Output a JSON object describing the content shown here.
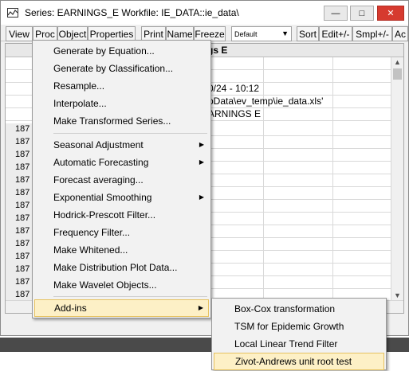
{
  "window": {
    "title": "Series: EARNINGS_E   Workfile: IE_DATA::ie_data\\",
    "controls": {
      "minimize": "—",
      "maximize": "□",
      "close": "✕"
    }
  },
  "toolbar": {
    "buttons": [
      "View",
      "Proc",
      "Object",
      "Properties",
      "Print",
      "Name",
      "Freeze",
      "Sort",
      "Edit+/-",
      "Smpl+/-",
      "Ac"
    ],
    "dropdown_value": "Default"
  },
  "sheet": {
    "header_title": "gs E",
    "cells": {
      "date_line": "0/24 - 10:12",
      "path_line": "pData\\ev_temp\\ie_data.xls'",
      "name_line": "ARNINGS E"
    },
    "row_labels": [
      "187",
      "187",
      "187",
      "187",
      "187",
      "187",
      "187",
      "187",
      "187",
      "187",
      "187",
      "187",
      "187",
      "187"
    ]
  },
  "proc_menu": {
    "items": [
      {
        "label": "Generate by Equation...",
        "submenu": false
      },
      {
        "label": "Generate by Classification...",
        "submenu": false
      },
      {
        "label": "Resample...",
        "submenu": false
      },
      {
        "label": "Interpolate...",
        "submenu": false
      },
      {
        "label": "Make Transformed Series...",
        "submenu": false
      },
      {
        "label": "Seasonal Adjustment",
        "submenu": true
      },
      {
        "label": "Automatic Forecasting",
        "submenu": true
      },
      {
        "label": "Forecast averaging...",
        "submenu": false
      },
      {
        "label": "Exponential Smoothing",
        "submenu": true
      },
      {
        "label": "Hodrick-Prescott Filter...",
        "submenu": false
      },
      {
        "label": "Frequency Filter...",
        "submenu": false
      },
      {
        "label": "Make Whitened...",
        "submenu": false
      },
      {
        "label": "Make Distribution Plot Data...",
        "submenu": false
      },
      {
        "label": "Make Wavelet Objects...",
        "submenu": false
      },
      {
        "label": "Add-ins",
        "submenu": true,
        "highlighted": true
      }
    ]
  },
  "addins_menu": {
    "items": [
      {
        "label": "Box-Cox transformation"
      },
      {
        "label": "TSM for Epidemic Growth"
      },
      {
        "label": "Local Linear Trend Filter"
      },
      {
        "label": "Zivot-Andrews unit root test",
        "highlighted": true
      }
    ]
  },
  "colors": {
    "menu_bg": "#f2f2f2",
    "highlight": "#fdf0c6",
    "highlight_border": "#e7c260",
    "close_button": "#d63a2f"
  }
}
